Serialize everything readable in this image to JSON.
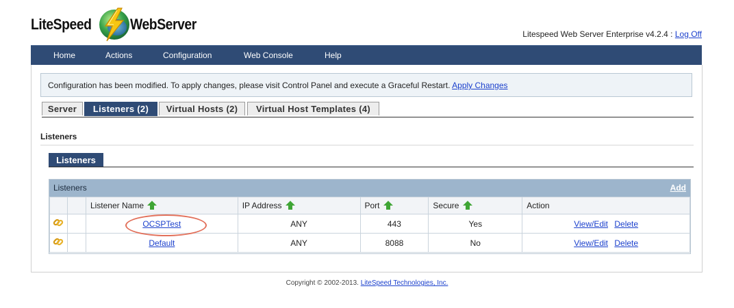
{
  "header": {
    "logo_left": "LiteSpeed",
    "logo_right": "WebServer",
    "product": "Litespeed Web Server Enterprise v4.2.4",
    "separator": " : ",
    "logoff": "Log Off"
  },
  "nav": [
    "Home",
    "Actions",
    "Configuration",
    "Web Console",
    "Help"
  ],
  "notice": {
    "message": "Configuration has been modified. To apply changes, please visit Control Panel and execute a Graceful Restart. ",
    "link": "Apply Changes"
  },
  "tabs": [
    {
      "label": "Server",
      "active": false
    },
    {
      "label": "Listeners (2)",
      "active": true
    },
    {
      "label": "Virtual Hosts (2)",
      "active": false
    },
    {
      "label": "Virtual Host Templates (4)",
      "active": false
    }
  ],
  "section_title": "Listeners",
  "subtab": "Listeners",
  "table": {
    "title": "Listeners",
    "add_label": "Add",
    "columns": [
      "Listener Name",
      "IP Address",
      "Port",
      "Secure",
      "Action"
    ],
    "rows": [
      {
        "name": "OCSPTest",
        "ip": "ANY",
        "port": "443",
        "secure": "Yes",
        "view": "View/Edit",
        "delete": "Delete"
      },
      {
        "name": "Default",
        "ip": "ANY",
        "port": "8088",
        "secure": "No",
        "view": "View/Edit",
        "delete": "Delete"
      }
    ]
  },
  "footer": {
    "text": "Copyright © 2002-2013. ",
    "link": "LiteSpeed Technologies, Inc."
  },
  "colors": {
    "nav_bg": "#2f4b75",
    "table_head": "#9db5cc",
    "sort_arrow": "#3fa535",
    "highlight": "#e2705a"
  }
}
